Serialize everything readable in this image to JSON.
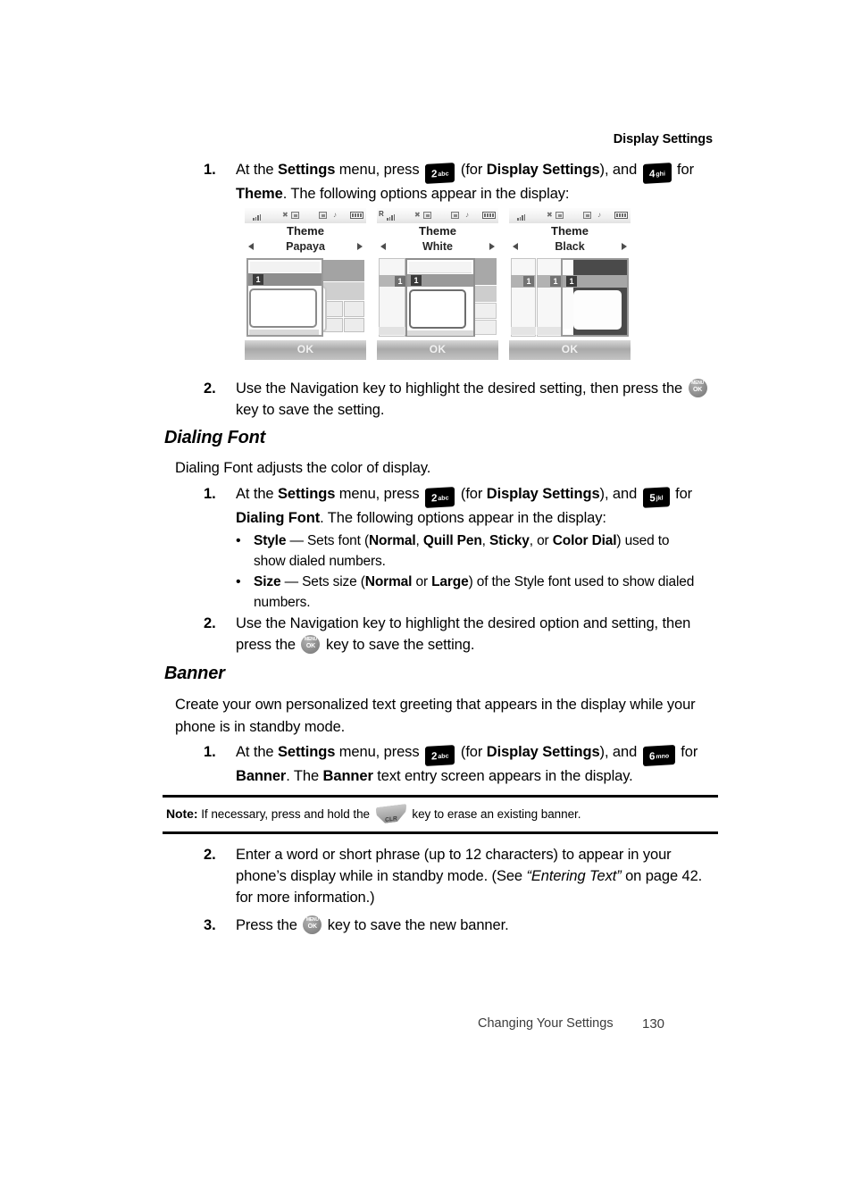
{
  "running_head": "Display Settings",
  "sections": {
    "theme": {
      "step1": {
        "number": "1.",
        "parts": [
          {
            "t": "At the "
          },
          {
            "t": "Settings",
            "b": true
          },
          {
            "t": " menu, press "
          },
          {
            "key": {
              "digit": "2",
              "letters": "abc"
            }
          },
          {
            "t": " (for "
          },
          {
            "t": "Display Settings",
            "b": true
          },
          {
            "t": "), and "
          },
          {
            "key": {
              "digit": "4",
              "letters": "ghi"
            }
          },
          {
            "t": " for "
          },
          {
            "t": "Theme",
            "b": true
          },
          {
            "t": ". The following options appear in the display:"
          }
        ]
      },
      "step2": {
        "number": "2.",
        "parts": [
          {
            "t": "Use the Navigation key to highlight the desired setting, then press the "
          },
          {
            "okkey": {
              "top": "MENU",
              "bottom": "OK"
            }
          },
          {
            "t": " key to save the setting."
          }
        ]
      },
      "screens": [
        {
          "roaming": "",
          "title": "Theme",
          "value": "Papaya",
          "softkey": "OK",
          "badge": "1",
          "theme_style": "papaya"
        },
        {
          "roaming": "R",
          "title": "Theme",
          "value": "White",
          "softkey": "OK",
          "badge": "1",
          "theme_style": "white"
        },
        {
          "roaming": "",
          "title": "Theme",
          "value": "Black",
          "softkey": "OK",
          "badge": "1",
          "theme_style": "black"
        }
      ]
    },
    "dialing_font": {
      "heading": "Dialing Font",
      "intro": "Dialing Font adjusts the color of display.",
      "step1": {
        "number": "1.",
        "parts": [
          {
            "t": "At the "
          },
          {
            "t": "Settings",
            "b": true
          },
          {
            "t": " menu, press "
          },
          {
            "key": {
              "digit": "2",
              "letters": "abc"
            }
          },
          {
            "t": " (for "
          },
          {
            "t": "Display Settings",
            "b": true
          },
          {
            "t": "), and "
          },
          {
            "key": {
              "digit": "5",
              "letters": "jkl"
            }
          },
          {
            "t": " for "
          },
          {
            "t": "Dialing Font",
            "b": true
          },
          {
            "t": ". The following options appear in the display:"
          }
        ]
      },
      "bullets": [
        {
          "marker": "•",
          "parts": [
            {
              "t": "Style",
              "b": true
            },
            {
              "t": " — Sets font ("
            },
            {
              "t": "Normal",
              "b": true
            },
            {
              "t": ", "
            },
            {
              "t": "Quill Pen",
              "b": true
            },
            {
              "t": ", "
            },
            {
              "t": "Sticky",
              "b": true
            },
            {
              "t": ", or "
            },
            {
              "t": "Color Dial",
              "b": true
            },
            {
              "t": ") used to show dialed numbers."
            }
          ]
        },
        {
          "marker": "•",
          "parts": [
            {
              "t": "Size",
              "b": true
            },
            {
              "t": " — Sets size ("
            },
            {
              "t": "Normal",
              "b": true
            },
            {
              "t": " or "
            },
            {
              "t": "Large",
              "b": true
            },
            {
              "t": ") of the Style font used to show dialed numbers."
            }
          ]
        }
      ],
      "step2": {
        "number": "2.",
        "parts": [
          {
            "t": "Use the Navigation key to highlight the desired option and setting, then press the "
          },
          {
            "okkey": {
              "top": "MENU",
              "bottom": "OK"
            }
          },
          {
            "t": " key to save the setting."
          }
        ]
      }
    },
    "banner": {
      "heading": "Banner",
      "intro": "Create your own personalized text greeting that appears in the display while your phone is in standby mode.",
      "step1": {
        "number": "1.",
        "parts": [
          {
            "t": "At the "
          },
          {
            "t": "Settings",
            "b": true
          },
          {
            "t": " menu, press "
          },
          {
            "key": {
              "digit": "2",
              "letters": "abc"
            }
          },
          {
            "t": " (for "
          },
          {
            "t": "Display Settings",
            "b": true
          },
          {
            "t": "), and "
          },
          {
            "key": {
              "digit": "6",
              "letters": "mno"
            }
          },
          {
            "t": " for "
          },
          {
            "t": "Banner",
            "b": true
          },
          {
            "t": ". The "
          },
          {
            "t": "Banner",
            "b": true
          },
          {
            "t": " text entry screen appears in the display."
          }
        ]
      },
      "note": {
        "label": "Note:",
        "parts": [
          {
            "t": " If necessary, press and hold the "
          },
          {
            "clrkey": "CLR"
          },
          {
            "t": " key to erase an existing banner."
          }
        ]
      },
      "step2": {
        "number": "2.",
        "parts": [
          {
            "t": "Enter a word or short phrase (up to 12 characters) to appear in your phone’s display while in standby mode. (See "
          },
          {
            "t": "“Entering Text”",
            "i": true
          },
          {
            "t": " on page 42. for more information.)"
          }
        ]
      },
      "step3": {
        "number": "3.",
        "parts": [
          {
            "t": "Press the "
          },
          {
            "okkey": {
              "top": "MENU",
              "bottom": "OK"
            }
          },
          {
            "t": " key to save the new banner."
          }
        ]
      }
    }
  },
  "footer": {
    "text": "Changing Your Settings",
    "page_number": "130"
  },
  "colors": {
    "text": "#000000",
    "key_background": "#000000",
    "key_text": "#ffffff",
    "okkey_background": "#8f8f8f",
    "softkey_text": "#f2f2f2",
    "rule": "#000000"
  }
}
